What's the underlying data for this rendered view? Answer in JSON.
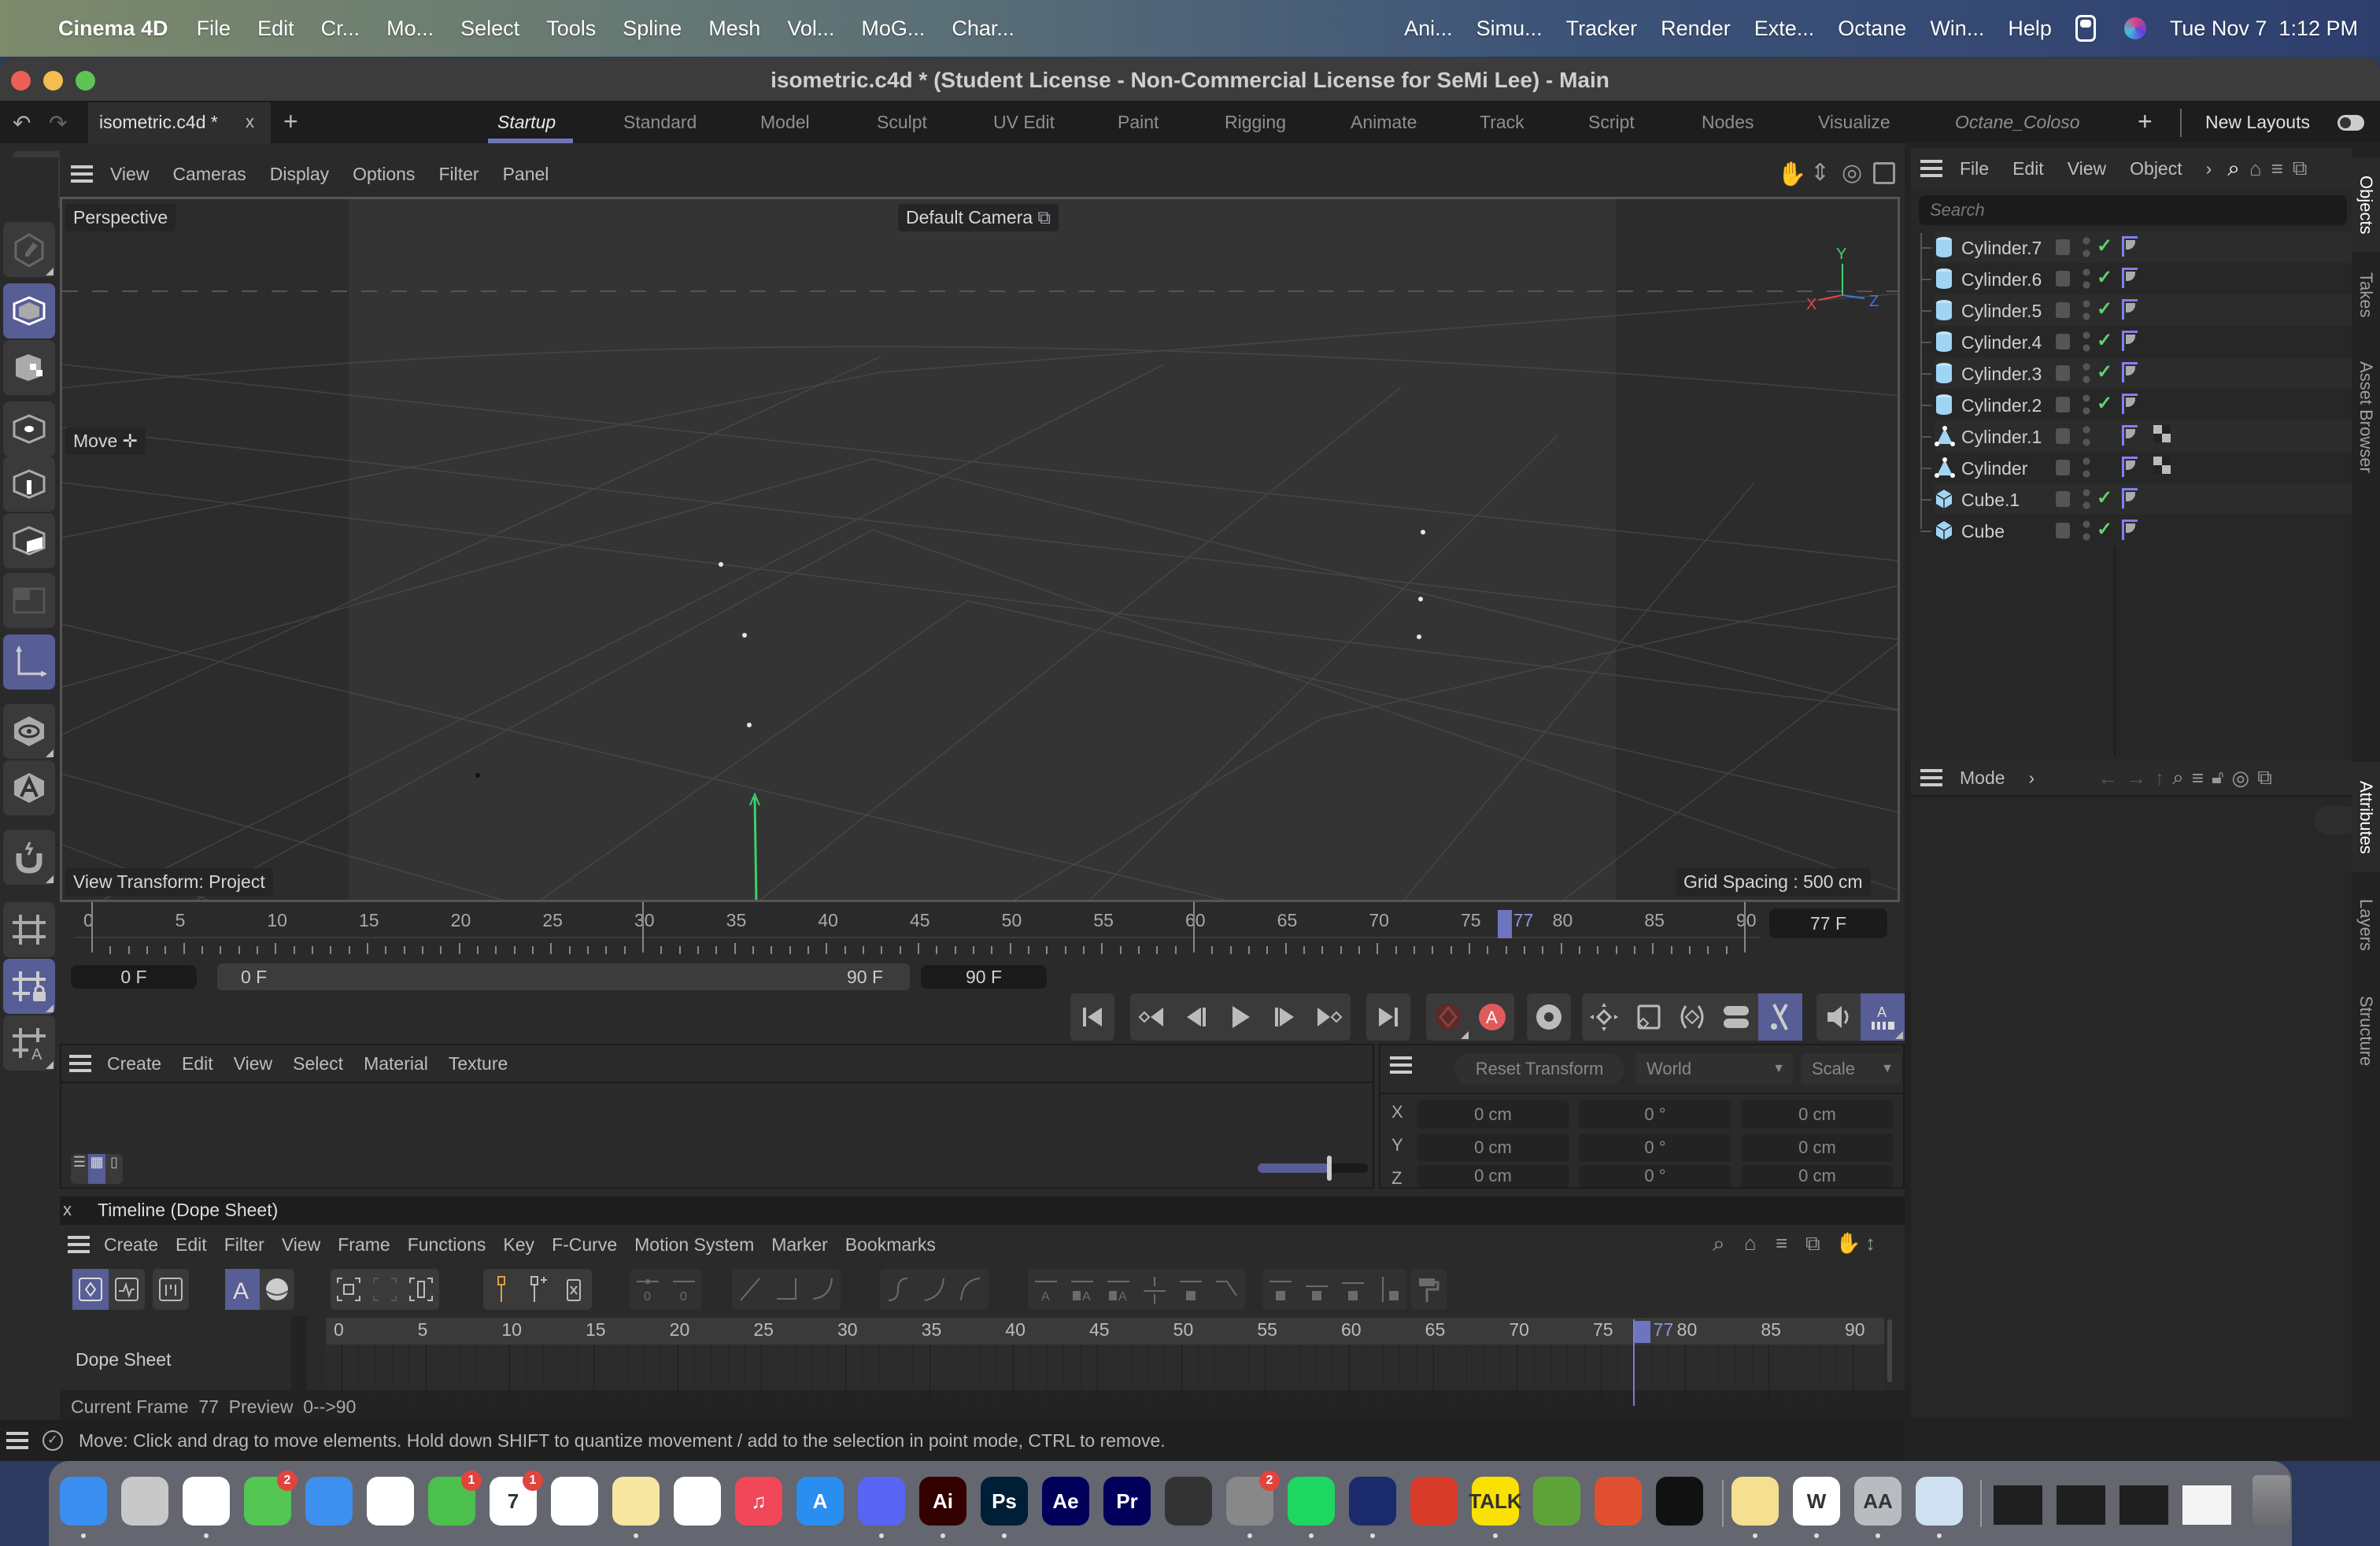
{
  "macos_menubar": {
    "app_name": "Cinema 4D",
    "items": [
      "File",
      "Edit",
      "Cr...",
      "Mo...",
      "Select",
      "Tools",
      "Spline",
      "Mesh",
      "Vol...",
      "MoG...",
      "Char..."
    ],
    "right_items": [
      "Ani...",
      "Simu...",
      "Tracker",
      "Render",
      "Exte...",
      "Octane",
      "Win...",
      "Help"
    ],
    "datetime": "Tue Nov 7  1:12 PM"
  },
  "window": {
    "title": "isometric.c4d * (Student License - Non-Commercial License for SeMi Lee) - Main"
  },
  "tabbar": {
    "doc_tab": "isometric.c4d *",
    "close": "x",
    "add": "+",
    "layouts": [
      "Startup",
      "Standard",
      "Model",
      "Sculpt",
      "UV Edit",
      "Paint",
      "Rigging",
      "Animate",
      "Track",
      "Script",
      "Nodes",
      "Visualize",
      "Octane_Coloso"
    ],
    "active_layout": "Startup",
    "new_layouts": "New Layouts"
  },
  "toolbar": {
    "axis_x": "X",
    "axis_y": "Y",
    "axis_z": "Z",
    "colors": {
      "x": "#e06060",
      "y": "#80e080",
      "z": "#4a88e0",
      "accent": "#575d95"
    }
  },
  "viewport": {
    "menu": [
      "View",
      "Cameras",
      "Display",
      "Options",
      "Filter",
      "Panel"
    ],
    "projection": "Perspective",
    "camera": "Default Camera",
    "tool_label": "Move",
    "view_transform": "View Transform: Project",
    "grid_spacing": "Grid Spacing : 500 cm",
    "gizmo": {
      "x": "X",
      "y": "Y",
      "z": "Z"
    }
  },
  "timeline": {
    "ticks": [
      "0",
      "5",
      "10",
      "15",
      "20",
      "25",
      "30",
      "35",
      "40",
      "45",
      "50",
      "55",
      "60",
      "65",
      "70",
      "75",
      "80",
      "85",
      "90"
    ],
    "current_frame": "77",
    "current_frame_field": "77 F",
    "start_field": "0 F",
    "range_start": "0 F",
    "range_end": "90 F",
    "end_field": "90 F",
    "record_label": "A",
    "autokey_label": "A"
  },
  "material_manager": {
    "menu": [
      "Create",
      "Edit",
      "View",
      "Select",
      "Material",
      "Texture"
    ],
    "zoom_slider_value": 0.65
  },
  "coordinates": {
    "reset_button": "Reset Transform",
    "space": "World",
    "mode": "Scale",
    "rows": [
      {
        "axis": "X",
        "pos": "0 cm",
        "rot": "0 °",
        "scale": "0 cm"
      },
      {
        "axis": "Y",
        "pos": "0 cm",
        "rot": "0 °",
        "scale": "0 cm"
      },
      {
        "axis": "Z",
        "pos": "0 cm",
        "rot": "0 °",
        "scale": "0 cm"
      }
    ]
  },
  "dopesheet": {
    "panel_title": "Timeline (Dope Sheet)",
    "close": "x",
    "menu": [
      "Create",
      "Edit",
      "Filter",
      "View",
      "Frame",
      "Functions",
      "Key",
      "F-Curve",
      "Motion System",
      "Marker",
      "Bookmarks"
    ],
    "track_label": "Dope Sheet",
    "ticks": [
      "0",
      "5",
      "10",
      "15",
      "20",
      "25",
      "30",
      "35",
      "40",
      "45",
      "50",
      "55",
      "60",
      "65",
      "70",
      "75",
      "80",
      "85",
      "90"
    ],
    "current_frame": "77",
    "footer": "Current Frame  77  Preview  0-->90"
  },
  "statusbar": {
    "text": "Move: Click and drag to move elements. Hold down SHIFT to quantize movement / add to the selection in point mode, CTRL to remove."
  },
  "objects_panel": {
    "menu": [
      "File",
      "Edit",
      "View",
      "Object"
    ],
    "search_placeholder": "Search",
    "items": [
      {
        "name": "Cylinder.7",
        "type": "cylinder",
        "enabled": true,
        "texture": false
      },
      {
        "name": "Cylinder.6",
        "type": "cylinder",
        "enabled": true,
        "texture": false
      },
      {
        "name": "Cylinder.5",
        "type": "cylinder",
        "enabled": true,
        "texture": false
      },
      {
        "name": "Cylinder.4",
        "type": "cylinder",
        "enabled": true,
        "texture": false
      },
      {
        "name": "Cylinder.3",
        "type": "cylinder",
        "enabled": true,
        "texture": false
      },
      {
        "name": "Cylinder.2",
        "type": "cylinder",
        "enabled": true,
        "texture": false
      },
      {
        "name": "Cylinder.1",
        "type": "polygon",
        "enabled": false,
        "texture": true
      },
      {
        "name": "Cylinder",
        "type": "polygon",
        "enabled": false,
        "texture": true
      },
      {
        "name": "Cube.1",
        "type": "cube",
        "enabled": true,
        "texture": false
      },
      {
        "name": "Cube",
        "type": "cube",
        "enabled": true,
        "texture": false
      }
    ],
    "side_tabs_top": [
      "Objects",
      "Takes",
      "Asset Browser"
    ],
    "side_tabs_bottom": [
      "Attributes",
      "Layers",
      "Structure"
    ]
  },
  "attributes_panel": {
    "mode_label": "Mode"
  },
  "dock": {
    "apps": [
      {
        "name": "Finder",
        "color": "#3a8ef0",
        "label": ""
      },
      {
        "name": "Launchpad",
        "color": "#c8c8c8",
        "label": ""
      },
      {
        "name": "Safari",
        "color": "#ffffff",
        "label": ""
      },
      {
        "name": "Messages",
        "color": "#53c653",
        "label": "",
        "badge": "2"
      },
      {
        "name": "Mail",
        "color": "#3d8ff0",
        "label": ""
      },
      {
        "name": "Photos",
        "color": "#ffffff",
        "label": ""
      },
      {
        "name": "FaceTime",
        "color": "#4cc04c",
        "label": "",
        "badge": "1"
      },
      {
        "name": "Calendar",
        "color": "#ffffff",
        "label": "7",
        "badge": "1"
      },
      {
        "name": "Reminders",
        "color": "#ffffff",
        "label": ""
      },
      {
        "name": "Notes",
        "color": "#f7e6a0",
        "label": ""
      },
      {
        "name": "Freeform",
        "color": "#ffffff",
        "label": ""
      },
      {
        "name": "Music",
        "color": "#f04858",
        "label": "♫"
      },
      {
        "name": "App Store",
        "color": "#2a8ef0",
        "label": "A"
      },
      {
        "name": "Discord",
        "color": "#5865f2",
        "label": ""
      },
      {
        "name": "Illustrator",
        "color": "#330000",
        "label": "Ai"
      },
      {
        "name": "Photoshop",
        "color": "#001e36",
        "label": "Ps"
      },
      {
        "name": "After Effects",
        "color": "#00005b",
        "label": "Ae"
      },
      {
        "name": "Premiere Pro",
        "color": "#00005b",
        "label": "Pr"
      },
      {
        "name": "Final Cut Pro",
        "color": "#333333",
        "label": ""
      },
      {
        "name": "System Settings",
        "color": "#888888",
        "label": "",
        "badge": "2"
      },
      {
        "name": "Spotify",
        "color": "#1ed760",
        "label": ""
      },
      {
        "name": "Cinema 4D",
        "color": "#1b2a6a",
        "label": ""
      },
      {
        "name": "Photo Booth",
        "color": "#d83a2a",
        "label": ""
      },
      {
        "name": "KakaoTalk",
        "color": "#fae100",
        "label": "TALK"
      },
      {
        "name": "Minecraft",
        "color": "#5ea33a",
        "label": ""
      },
      {
        "name": "Digital Color Meter",
        "color": "#e05030",
        "label": ""
      },
      {
        "name": "Activity Monitor",
        "color": "#111111",
        "label": ""
      },
      {
        "name": "Stickies",
        "color": "#f4e090",
        "label": ""
      },
      {
        "name": "Word",
        "color": "#ffffff",
        "label": "W"
      },
      {
        "name": "Font Book",
        "color": "#b8bcc0",
        "label": "AA"
      },
      {
        "name": "Preview",
        "color": "#cfe0f0",
        "label": ""
      }
    ],
    "recent": [
      "window-1",
      "window-2",
      "window-3",
      "document"
    ],
    "trash": "Trash"
  }
}
